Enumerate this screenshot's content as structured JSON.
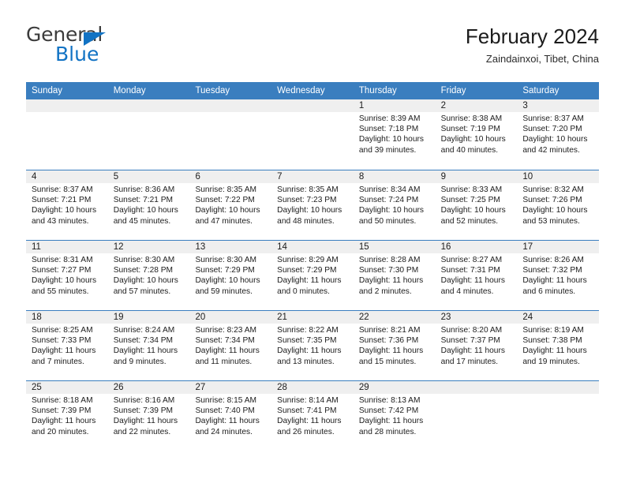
{
  "brand": {
    "name_top": "General",
    "name_bottom": "Blue",
    "accent_color": "#1273c4"
  },
  "header": {
    "title": "February 2024",
    "subtitle": "Zaindainxoi, Tibet, China"
  },
  "theme": {
    "header_bg": "#3a7ebf",
    "day_num_bg": "#efefef",
    "text_color": "#1c1c1c"
  },
  "weekdays": [
    "Sunday",
    "Monday",
    "Tuesday",
    "Wednesday",
    "Thursday",
    "Friday",
    "Saturday"
  ],
  "weeks": [
    [
      {
        "day": "",
        "sunrise": "",
        "sunset": "",
        "daylight": "",
        "daylight2": "",
        "empty": true
      },
      {
        "day": "",
        "sunrise": "",
        "sunset": "",
        "daylight": "",
        "daylight2": "",
        "empty": true
      },
      {
        "day": "",
        "sunrise": "",
        "sunset": "",
        "daylight": "",
        "daylight2": "",
        "empty": true
      },
      {
        "day": "",
        "sunrise": "",
        "sunset": "",
        "daylight": "",
        "daylight2": "",
        "empty": true
      },
      {
        "day": "1",
        "sunrise": "Sunrise: 8:39 AM",
        "sunset": "Sunset: 7:18 PM",
        "daylight": "Daylight: 10 hours",
        "daylight2": "and 39 minutes.",
        "empty": false
      },
      {
        "day": "2",
        "sunrise": "Sunrise: 8:38 AM",
        "sunset": "Sunset: 7:19 PM",
        "daylight": "Daylight: 10 hours",
        "daylight2": "and 40 minutes.",
        "empty": false
      },
      {
        "day": "3",
        "sunrise": "Sunrise: 8:37 AM",
        "sunset": "Sunset: 7:20 PM",
        "daylight": "Daylight: 10 hours",
        "daylight2": "and 42 minutes.",
        "empty": false
      }
    ],
    [
      {
        "day": "4",
        "sunrise": "Sunrise: 8:37 AM",
        "sunset": "Sunset: 7:21 PM",
        "daylight": "Daylight: 10 hours",
        "daylight2": "and 43 minutes.",
        "empty": false
      },
      {
        "day": "5",
        "sunrise": "Sunrise: 8:36 AM",
        "sunset": "Sunset: 7:21 PM",
        "daylight": "Daylight: 10 hours",
        "daylight2": "and 45 minutes.",
        "empty": false
      },
      {
        "day": "6",
        "sunrise": "Sunrise: 8:35 AM",
        "sunset": "Sunset: 7:22 PM",
        "daylight": "Daylight: 10 hours",
        "daylight2": "and 47 minutes.",
        "empty": false
      },
      {
        "day": "7",
        "sunrise": "Sunrise: 8:35 AM",
        "sunset": "Sunset: 7:23 PM",
        "daylight": "Daylight: 10 hours",
        "daylight2": "and 48 minutes.",
        "empty": false
      },
      {
        "day": "8",
        "sunrise": "Sunrise: 8:34 AM",
        "sunset": "Sunset: 7:24 PM",
        "daylight": "Daylight: 10 hours",
        "daylight2": "and 50 minutes.",
        "empty": false
      },
      {
        "day": "9",
        "sunrise": "Sunrise: 8:33 AM",
        "sunset": "Sunset: 7:25 PM",
        "daylight": "Daylight: 10 hours",
        "daylight2": "and 52 minutes.",
        "empty": false
      },
      {
        "day": "10",
        "sunrise": "Sunrise: 8:32 AM",
        "sunset": "Sunset: 7:26 PM",
        "daylight": "Daylight: 10 hours",
        "daylight2": "and 53 minutes.",
        "empty": false
      }
    ],
    [
      {
        "day": "11",
        "sunrise": "Sunrise: 8:31 AM",
        "sunset": "Sunset: 7:27 PM",
        "daylight": "Daylight: 10 hours",
        "daylight2": "and 55 minutes.",
        "empty": false
      },
      {
        "day": "12",
        "sunrise": "Sunrise: 8:30 AM",
        "sunset": "Sunset: 7:28 PM",
        "daylight": "Daylight: 10 hours",
        "daylight2": "and 57 minutes.",
        "empty": false
      },
      {
        "day": "13",
        "sunrise": "Sunrise: 8:30 AM",
        "sunset": "Sunset: 7:29 PM",
        "daylight": "Daylight: 10 hours",
        "daylight2": "and 59 minutes.",
        "empty": false
      },
      {
        "day": "14",
        "sunrise": "Sunrise: 8:29 AM",
        "sunset": "Sunset: 7:29 PM",
        "daylight": "Daylight: 11 hours",
        "daylight2": "and 0 minutes.",
        "empty": false
      },
      {
        "day": "15",
        "sunrise": "Sunrise: 8:28 AM",
        "sunset": "Sunset: 7:30 PM",
        "daylight": "Daylight: 11 hours",
        "daylight2": "and 2 minutes.",
        "empty": false
      },
      {
        "day": "16",
        "sunrise": "Sunrise: 8:27 AM",
        "sunset": "Sunset: 7:31 PM",
        "daylight": "Daylight: 11 hours",
        "daylight2": "and 4 minutes.",
        "empty": false
      },
      {
        "day": "17",
        "sunrise": "Sunrise: 8:26 AM",
        "sunset": "Sunset: 7:32 PM",
        "daylight": "Daylight: 11 hours",
        "daylight2": "and 6 minutes.",
        "empty": false
      }
    ],
    [
      {
        "day": "18",
        "sunrise": "Sunrise: 8:25 AM",
        "sunset": "Sunset: 7:33 PM",
        "daylight": "Daylight: 11 hours",
        "daylight2": "and 7 minutes.",
        "empty": false
      },
      {
        "day": "19",
        "sunrise": "Sunrise: 8:24 AM",
        "sunset": "Sunset: 7:34 PM",
        "daylight": "Daylight: 11 hours",
        "daylight2": "and 9 minutes.",
        "empty": false
      },
      {
        "day": "20",
        "sunrise": "Sunrise: 8:23 AM",
        "sunset": "Sunset: 7:34 PM",
        "daylight": "Daylight: 11 hours",
        "daylight2": "and 11 minutes.",
        "empty": false
      },
      {
        "day": "21",
        "sunrise": "Sunrise: 8:22 AM",
        "sunset": "Sunset: 7:35 PM",
        "daylight": "Daylight: 11 hours",
        "daylight2": "and 13 minutes.",
        "empty": false
      },
      {
        "day": "22",
        "sunrise": "Sunrise: 8:21 AM",
        "sunset": "Sunset: 7:36 PM",
        "daylight": "Daylight: 11 hours",
        "daylight2": "and 15 minutes.",
        "empty": false
      },
      {
        "day": "23",
        "sunrise": "Sunrise: 8:20 AM",
        "sunset": "Sunset: 7:37 PM",
        "daylight": "Daylight: 11 hours",
        "daylight2": "and 17 minutes.",
        "empty": false
      },
      {
        "day": "24",
        "sunrise": "Sunrise: 8:19 AM",
        "sunset": "Sunset: 7:38 PM",
        "daylight": "Daylight: 11 hours",
        "daylight2": "and 19 minutes.",
        "empty": false
      }
    ],
    [
      {
        "day": "25",
        "sunrise": "Sunrise: 8:18 AM",
        "sunset": "Sunset: 7:39 PM",
        "daylight": "Daylight: 11 hours",
        "daylight2": "and 20 minutes.",
        "empty": false
      },
      {
        "day": "26",
        "sunrise": "Sunrise: 8:16 AM",
        "sunset": "Sunset: 7:39 PM",
        "daylight": "Daylight: 11 hours",
        "daylight2": "and 22 minutes.",
        "empty": false
      },
      {
        "day": "27",
        "sunrise": "Sunrise: 8:15 AM",
        "sunset": "Sunset: 7:40 PM",
        "daylight": "Daylight: 11 hours",
        "daylight2": "and 24 minutes.",
        "empty": false
      },
      {
        "day": "28",
        "sunrise": "Sunrise: 8:14 AM",
        "sunset": "Sunset: 7:41 PM",
        "daylight": "Daylight: 11 hours",
        "daylight2": "and 26 minutes.",
        "empty": false
      },
      {
        "day": "29",
        "sunrise": "Sunrise: 8:13 AM",
        "sunset": "Sunset: 7:42 PM",
        "daylight": "Daylight: 11 hours",
        "daylight2": "and 28 minutes.",
        "empty": false
      },
      {
        "day": "",
        "sunrise": "",
        "sunset": "",
        "daylight": "",
        "daylight2": "",
        "empty": true
      },
      {
        "day": "",
        "sunrise": "",
        "sunset": "",
        "daylight": "",
        "daylight2": "",
        "empty": true
      }
    ]
  ]
}
